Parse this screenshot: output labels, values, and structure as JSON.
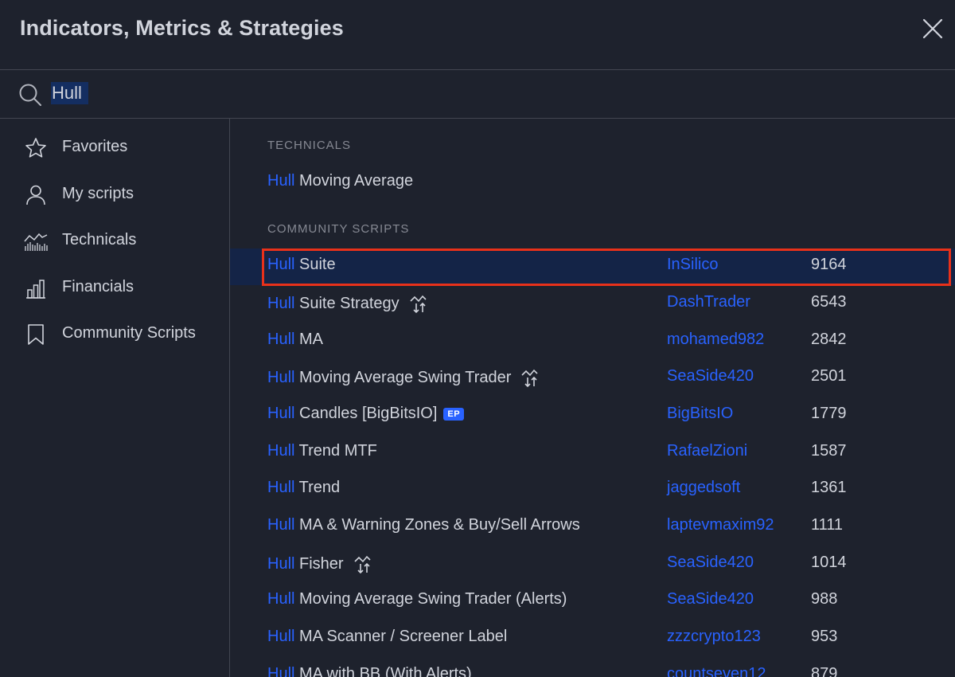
{
  "dialog": {
    "title": "Indicators, Metrics & Strategies"
  },
  "search": {
    "value": "Hull"
  },
  "sidebar": {
    "items": [
      {
        "label": "Favorites",
        "icon": "star-icon"
      },
      {
        "label": "My scripts",
        "icon": "user-icon"
      },
      {
        "label": "Technicals",
        "icon": "technicals-icon"
      },
      {
        "label": "Financials",
        "icon": "bar-chart-icon"
      },
      {
        "label": "Community Scripts",
        "icon": "bookmark-icon"
      }
    ]
  },
  "technicals": {
    "title": "TECHNICALS",
    "items": [
      {
        "match": "Hull",
        "rest": " Moving Average"
      }
    ]
  },
  "community": {
    "title": "COMMUNITY SCRIPTS",
    "items": [
      {
        "match": "Hull",
        "rest": " Suite",
        "author": "InSilico",
        "count": "9164",
        "selected": true
      },
      {
        "match": "Hull",
        "rest": " Suite Strategy",
        "author": "DashTrader",
        "count": "6543",
        "strategy": true
      },
      {
        "match": "Hull",
        "rest": " MA",
        "author": "mohamed982",
        "count": "2842"
      },
      {
        "match": "Hull",
        "rest": " Moving Average Swing Trader",
        "author": "SeaSide420",
        "count": "2501",
        "strategy": true
      },
      {
        "match": "Hull",
        "rest": " Candles [BigBitsIO]",
        "author": "BigBitsIO",
        "count": "1779",
        "badge": "EP"
      },
      {
        "match": "Hull",
        "rest": " Trend MTF",
        "author": "RafaelZioni",
        "count": "1587"
      },
      {
        "match": "Hull",
        "rest": " Trend",
        "author": "jaggedsoft",
        "count": "1361"
      },
      {
        "match": "Hull",
        "rest": " MA & Warning Zones & Buy/Sell Arrows",
        "author": "laptevmaxim92",
        "count": "1111"
      },
      {
        "match": "Hull",
        "rest": " Fisher",
        "author": "SeaSide420",
        "count": "1014",
        "strategy": true
      },
      {
        "match": "Hull",
        "rest": " Moving Average Swing Trader (Alerts)",
        "author": "SeaSide420",
        "count": "988"
      },
      {
        "match": "Hull",
        "rest": " MA Scanner / Screener Label",
        "author": "zzzcrypto123",
        "count": "953"
      },
      {
        "match": "Hull",
        "rest": " MA with BB (With Alerts)",
        "author": "countseven12",
        "count": "879"
      }
    ]
  },
  "colors": {
    "background": "#1e222d",
    "accent": "#2962ff",
    "selected_row": "#142447",
    "focus_outline": "#e8311a"
  }
}
